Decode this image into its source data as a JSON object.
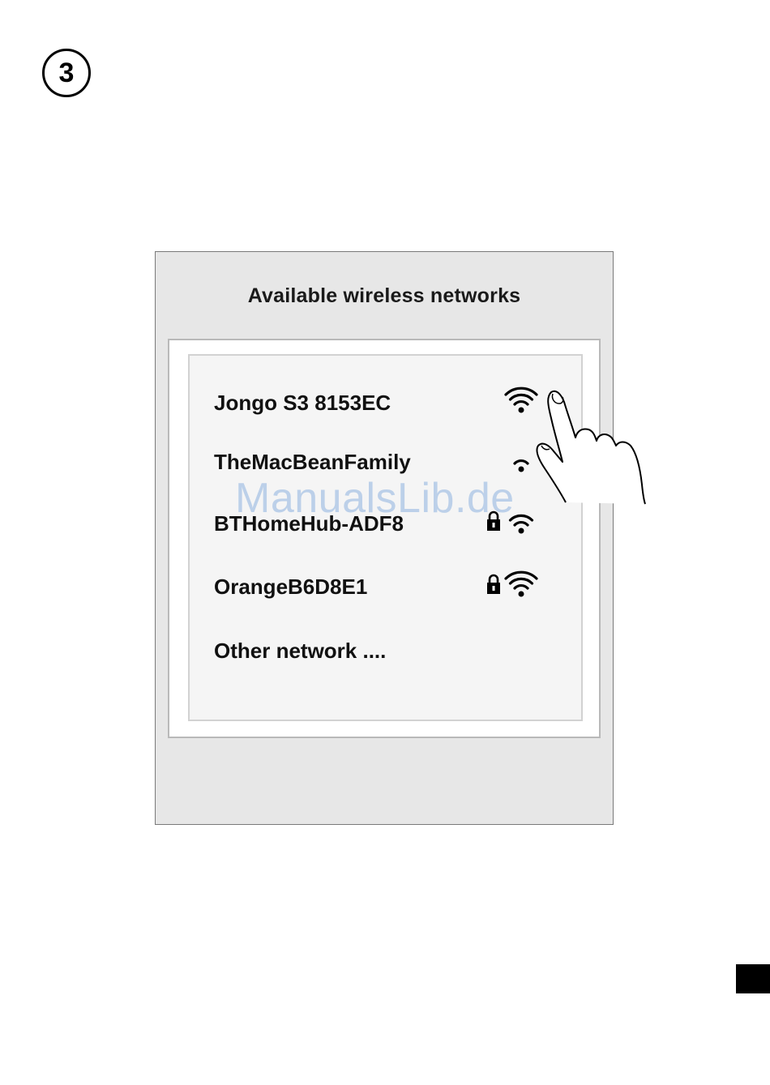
{
  "step": {
    "number": "3"
  },
  "dialog": {
    "title": "Available wireless networks",
    "networks": [
      {
        "name": "Jongo S3 8153EC",
        "locked": false,
        "signal_bars": 3
      },
      {
        "name": "TheMacBeanFamily",
        "locked": false,
        "signal_bars": 1
      },
      {
        "name": "BTHomeHub-ADF8",
        "locked": true,
        "signal_bars": 2
      },
      {
        "name": "OrangeB6D8E1",
        "locked": true,
        "signal_bars": 3
      },
      {
        "name": "Other network ....",
        "locked": false,
        "signal_bars": 0
      }
    ]
  },
  "watermark": {
    "text": "ManualsLib.de"
  },
  "icons": {
    "wifi": "wifi-signal-icon",
    "lock": "padlock-icon",
    "hand": "pointing-hand-icon"
  },
  "colors": {
    "panel_bg": "#e7e7e7",
    "list_bg": "#f5f5f5",
    "watermark": "#78a5dc"
  }
}
